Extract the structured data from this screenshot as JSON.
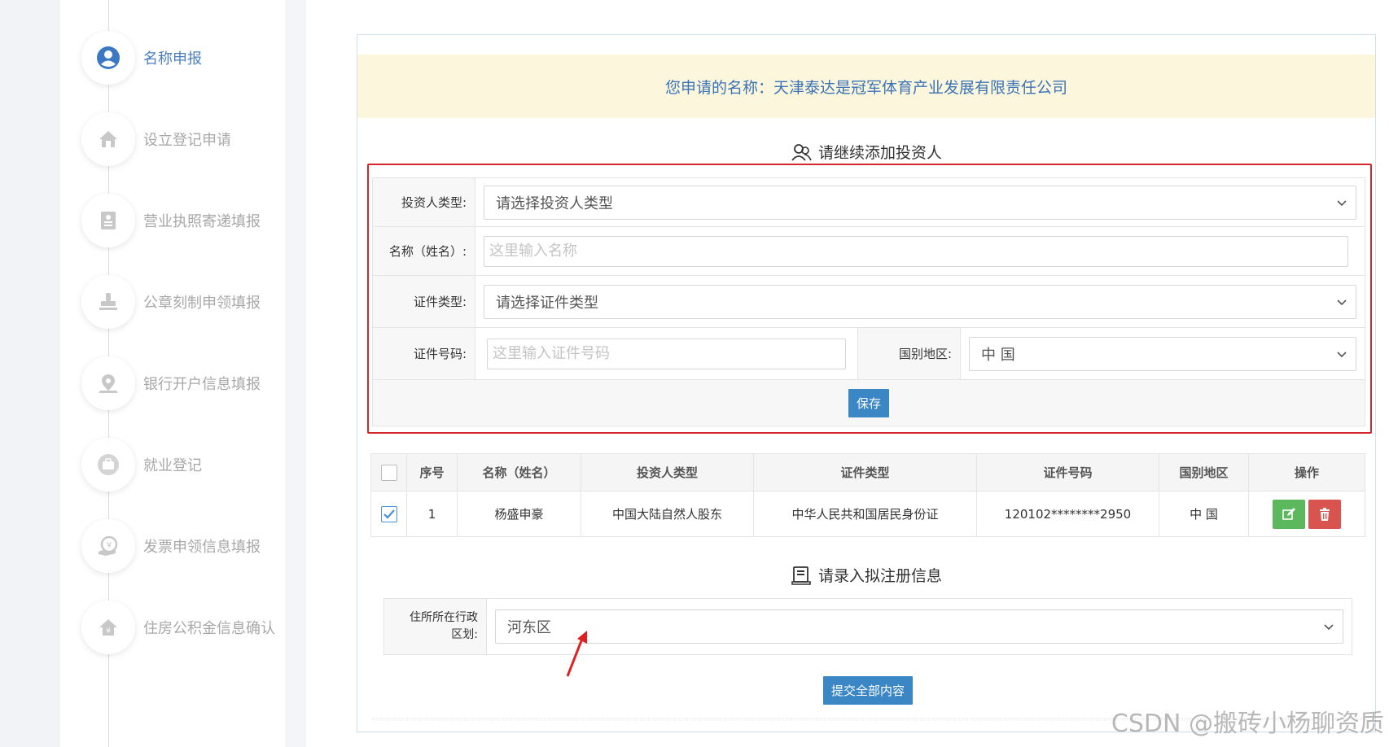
{
  "sidebar": {
    "steps": [
      {
        "label": "名称申报",
        "icon": "user-circle-icon",
        "active": true
      },
      {
        "label": "设立登记申请",
        "icon": "house-icon",
        "active": false
      },
      {
        "label": "营业执照寄递填报",
        "icon": "id-card-icon",
        "active": false
      },
      {
        "label": "公章刻制申领填报",
        "icon": "stamp-icon",
        "active": false
      },
      {
        "label": "银行开户信息填报",
        "icon": "location-pin-icon",
        "active": false
      },
      {
        "label": "就业登记",
        "icon": "briefcase-icon",
        "active": false
      },
      {
        "label": "发票申领信息填报",
        "icon": "invoice-icon",
        "active": false
      },
      {
        "label": "住房公积金信息确认",
        "icon": "home-fund-icon",
        "active": false
      }
    ]
  },
  "banner": {
    "text": "您申请的名称：天津泰达是冠军体育产业发展有限责任公司"
  },
  "investor_section": {
    "title": "请继续添加投资人",
    "type_label": "投资人类型:",
    "type_value": "请选择投资人类型",
    "name_label": "名称（姓名）:",
    "name_placeholder": "这里输入名称",
    "cert_type_label": "证件类型:",
    "cert_type_value": "请选择证件类型",
    "cert_no_label": "证件号码:",
    "cert_no_placeholder": "这里输入证件号码",
    "country_label": "国别地区:",
    "country_value": "中 国",
    "save_label": "保存"
  },
  "table": {
    "headers": [
      "序号",
      "名称（姓名）",
      "投资人类型",
      "证件类型",
      "证件号码",
      "国别地区",
      "操作"
    ],
    "rows": [
      {
        "checked": true,
        "no": "1",
        "name": "杨盛申豪",
        "investor_type": "中国大陆自然人股东",
        "cert_type": "中华人民共和国居民身份证",
        "cert_no": "120102********2950",
        "country": "中 国"
      }
    ]
  },
  "register_section": {
    "title": "请录入拟注册信息",
    "addr_label_1": "住所所在行政",
    "addr_label_2": "区划:",
    "addr_value": "河东区",
    "submit_label": "提交全部内容"
  },
  "watermark": "CSDN @搬砖小杨聊资质",
  "colors": {
    "accent_blue": "#3b86c4",
    "banner_bg": "#fcf6dc",
    "highlight_red": "#d9262c",
    "edit_green": "#5cb85c",
    "delete_red": "#d9534f"
  }
}
